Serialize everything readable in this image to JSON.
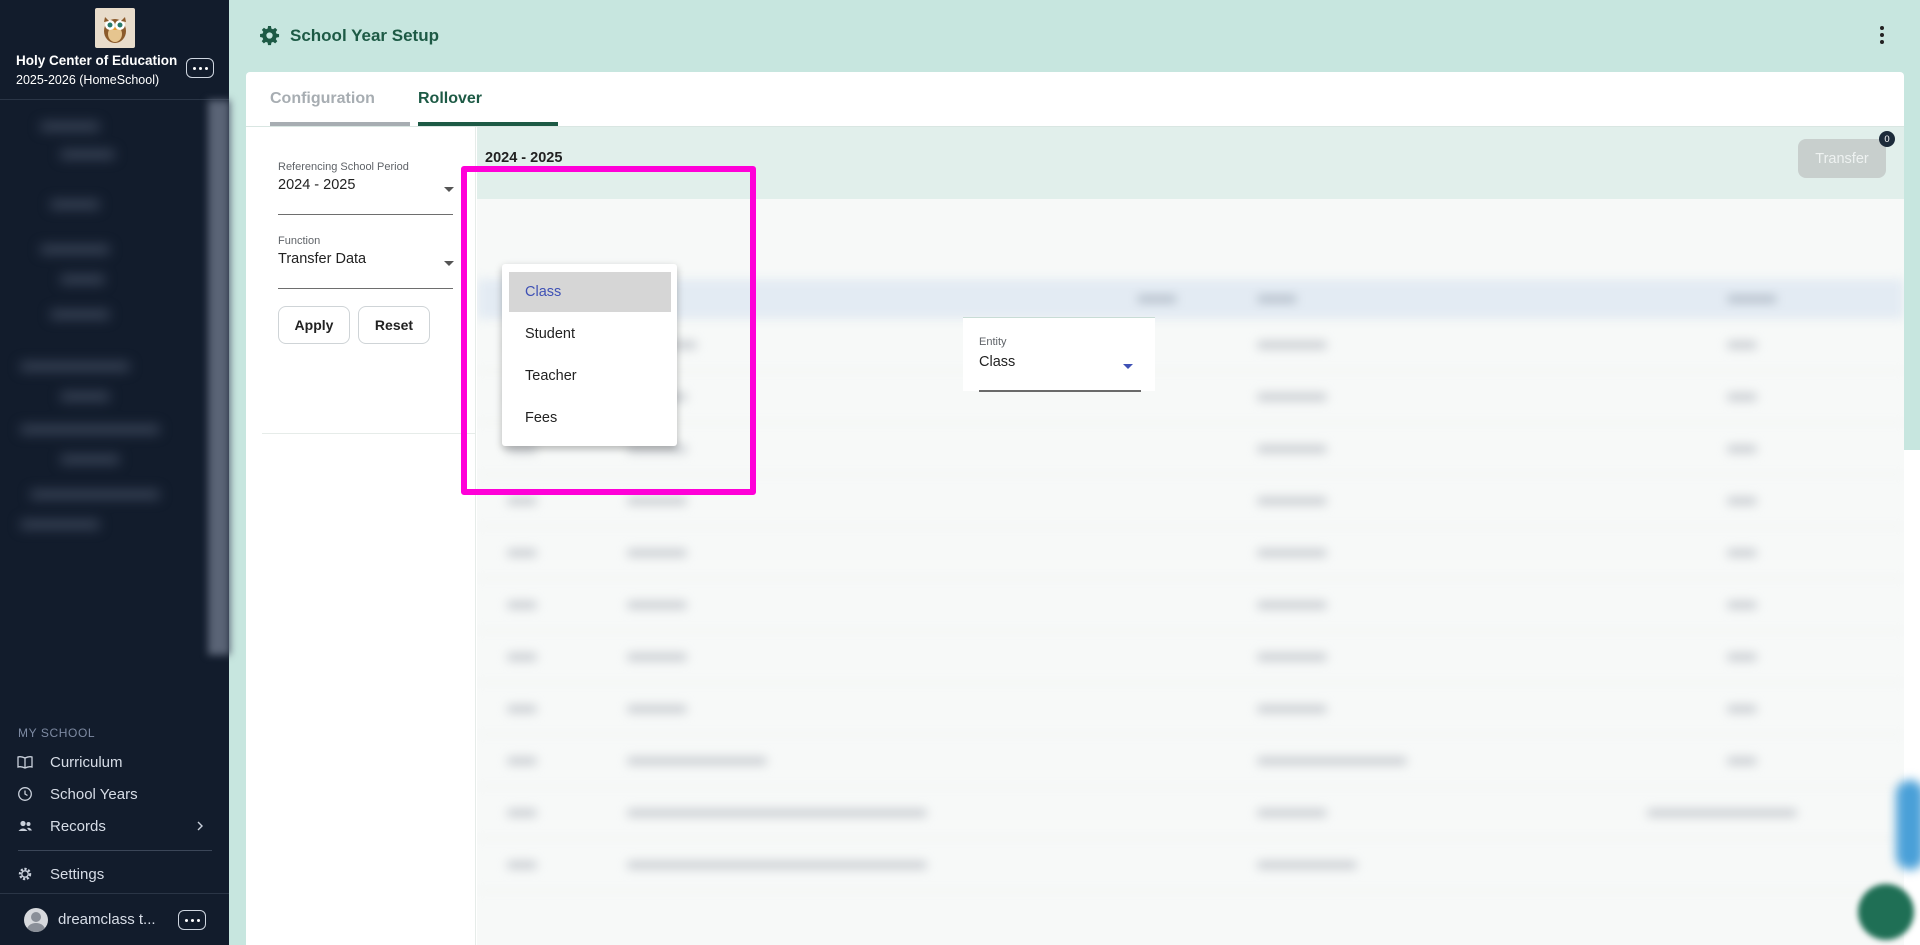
{
  "sidebar": {
    "school_name": "Holy Center of Education",
    "school_year": "2025-2026 (HomeSchool)",
    "section_label": "MY SCHOOL",
    "items": [
      {
        "label": "Curriculum",
        "icon": "book-icon"
      },
      {
        "label": "School Years",
        "icon": "clock-icon"
      },
      {
        "label": "Records",
        "icon": "people-icon",
        "has_submenu": true
      },
      {
        "label": "Settings",
        "icon": "gear-icon"
      }
    ],
    "user_name": "dreamclass t..."
  },
  "header": {
    "title": "School Year Setup",
    "title_icon": "gear-icon"
  },
  "tabs": [
    {
      "label": "Configuration",
      "active": false
    },
    {
      "label": "Rollover",
      "active": true
    }
  ],
  "filters": {
    "period_label": "Referencing School Period",
    "period_value": "2024 - 2025",
    "function_label": "Function",
    "function_value": "Transfer Data",
    "apply_label": "Apply",
    "reset_label": "Reset"
  },
  "content": {
    "period_heading": "2024 - 2025",
    "transfer_label": "Transfer",
    "transfer_count": "0"
  },
  "entity": {
    "label": "Entity",
    "value": "Class",
    "options": [
      "Class",
      "Student",
      "Teacher",
      "Fees"
    ],
    "selected_index": 0
  },
  "colors": {
    "sidebar_bg": "#121c2c",
    "header_bg": "#c7e6df",
    "brand_green": "#1d5a45",
    "highlight": "#ff00d8",
    "selected_option_text": "#3f51b5"
  }
}
